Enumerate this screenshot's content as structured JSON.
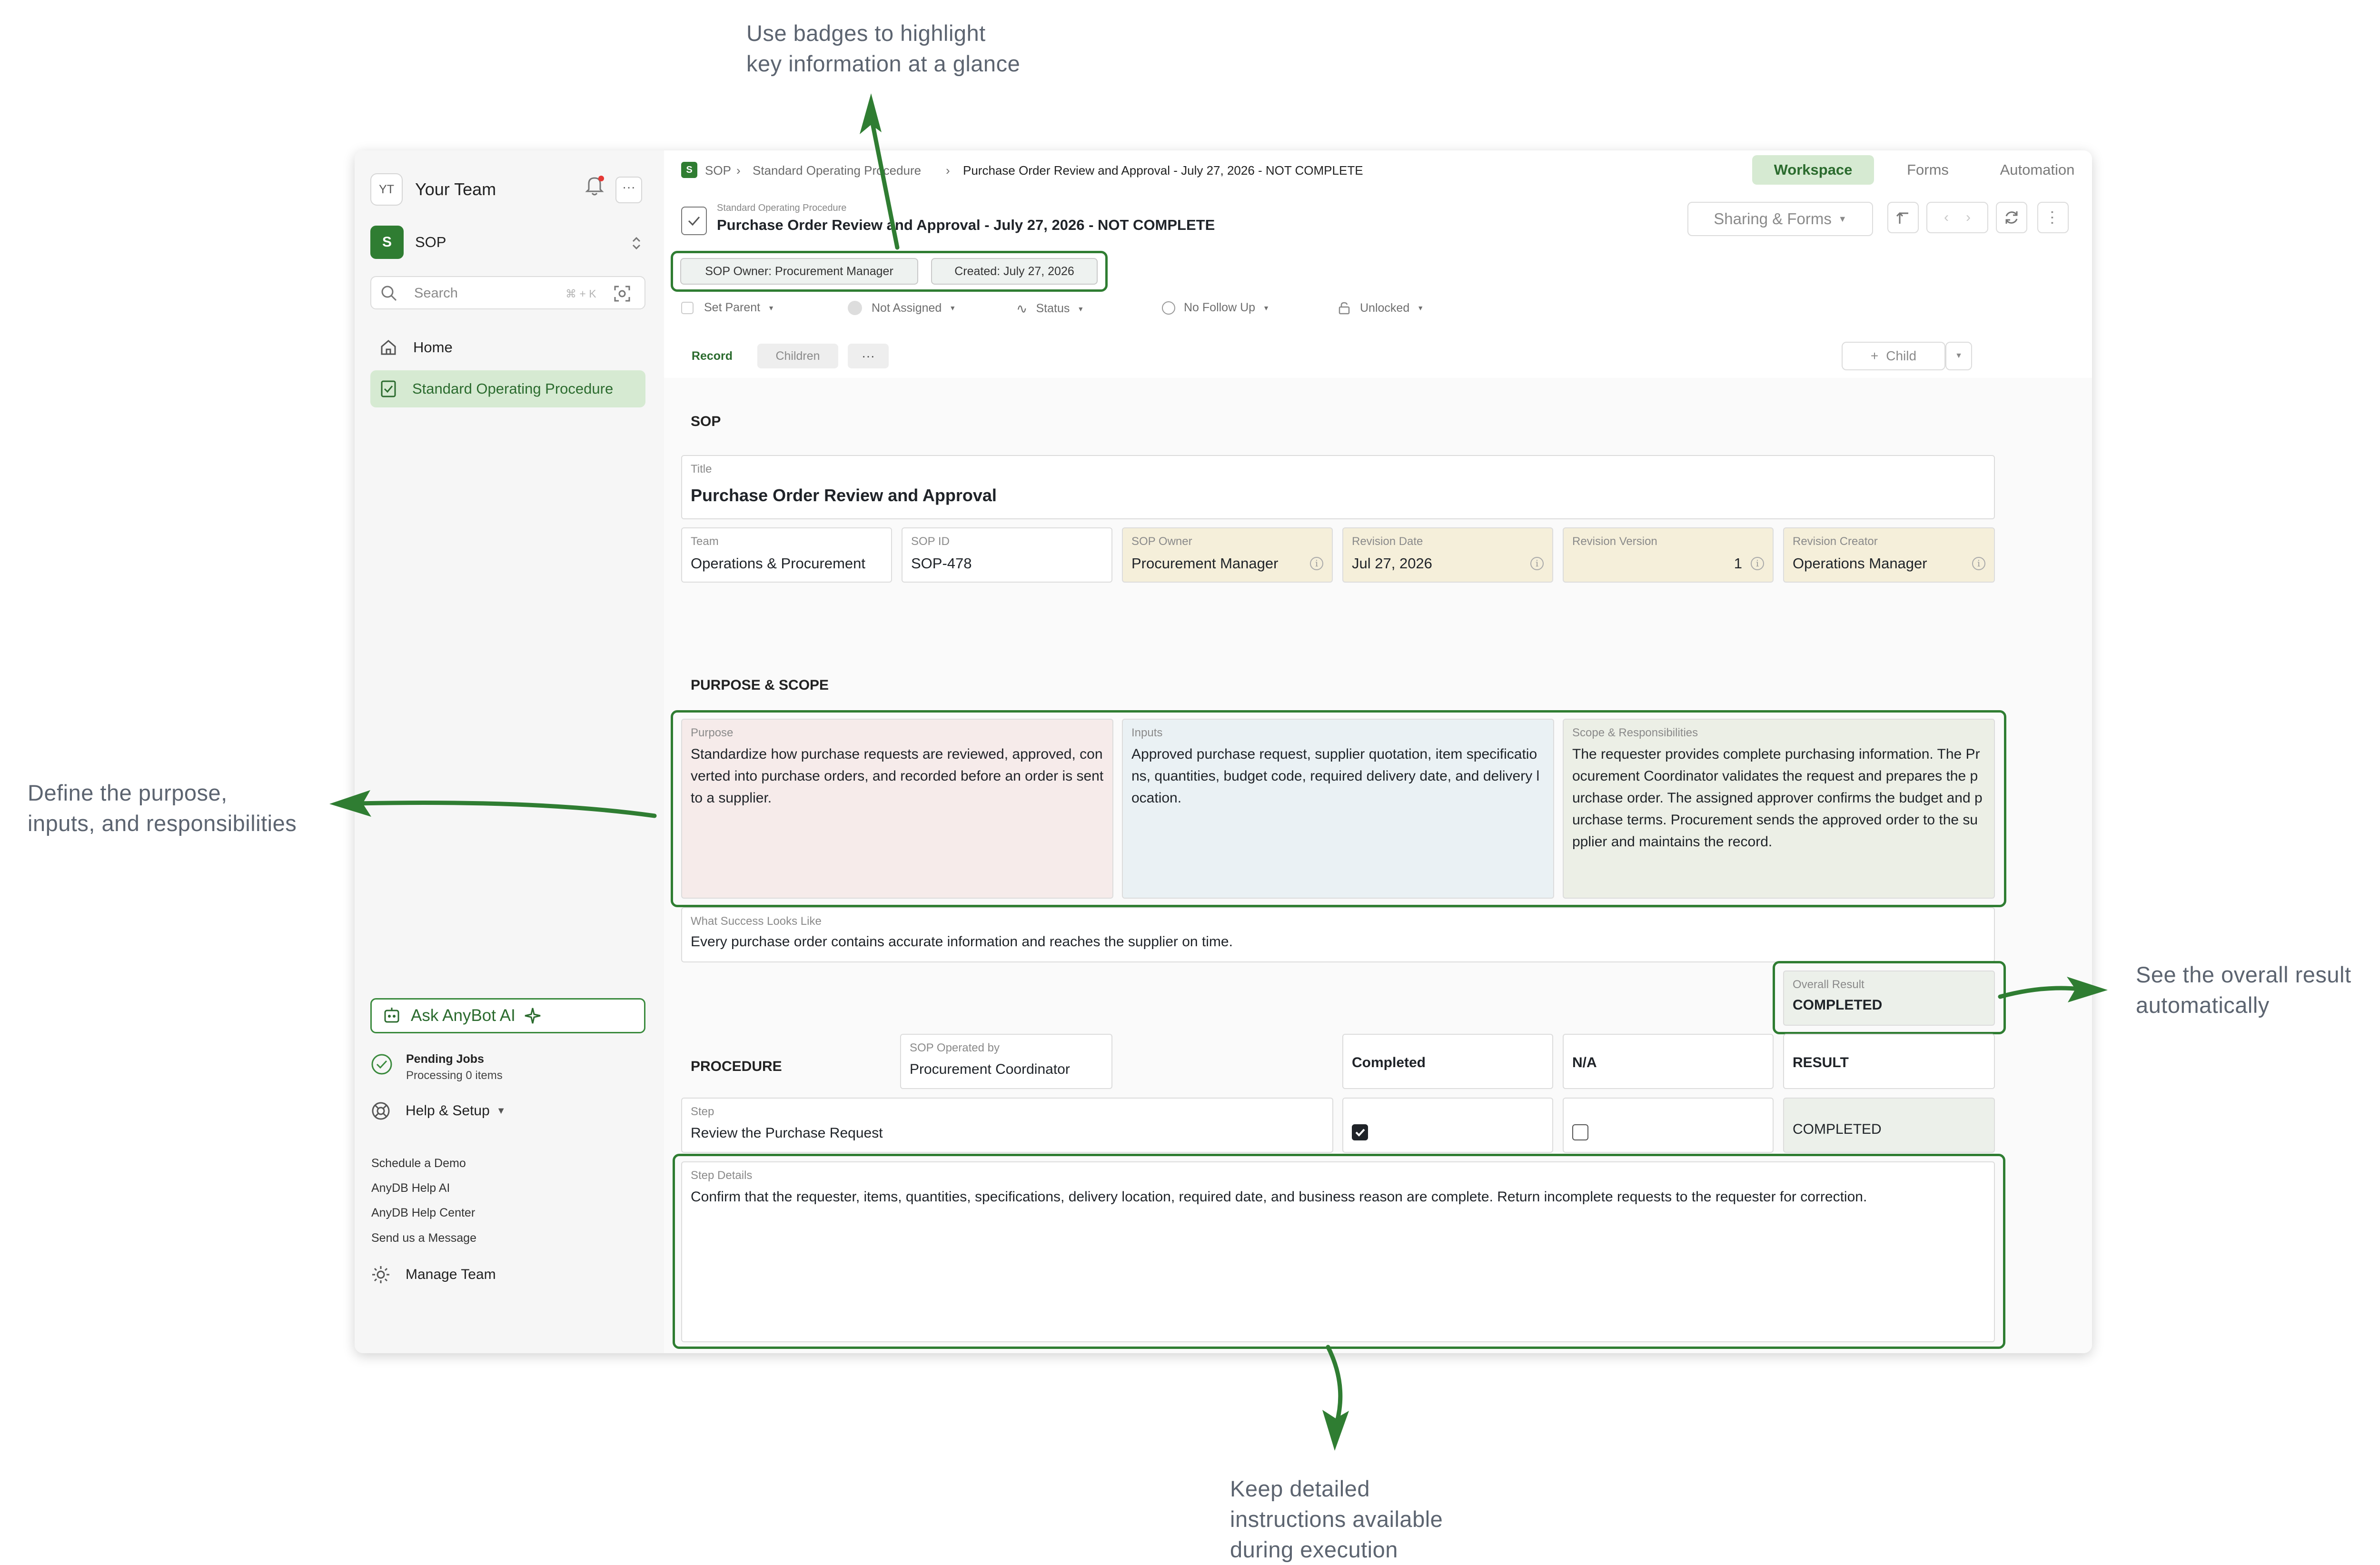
{
  "annotations": {
    "badges": [
      "Use badges to highlight",
      "key information at a glance"
    ],
    "purpose": [
      "Define the purpose,",
      "inputs, and responsibilities"
    ],
    "result": [
      "See the overall result",
      "automatically"
    ],
    "details": [
      "Keep detailed",
      "instructions available",
      "during execution"
    ]
  },
  "sidebar": {
    "team_initials": "YT",
    "team_name": "Your Team",
    "workspace_initial": "S",
    "workspace_name": "SOP",
    "search_placeholder": "Search",
    "search_shortcut": "⌘ + K",
    "nav": [
      {
        "label": "Home"
      },
      {
        "label": "Standard Operating Procedure"
      }
    ],
    "ask_label": "Ask AnyBot AI",
    "pending_title": "Pending Jobs",
    "pending_sub": "Processing 0 items",
    "help_label": "Help & Setup",
    "links": [
      "Schedule a Demo",
      "AnyDB Help AI",
      "AnyDB Help Center",
      "Send us a Message"
    ],
    "manage_team": "Manage Team"
  },
  "header": {
    "breadcrumb": [
      "SOP",
      "Standard Operating Procedure",
      "Purchase Order Review and Approval - July 27, 2026 - NOT COMPLETE"
    ],
    "tabs": [
      "Workspace",
      "Forms",
      "Automation"
    ],
    "record_type": "Standard Operating Procedure",
    "record_title": "Purchase Order Review and Approval - July 27, 2026 - NOT COMPLETE",
    "sharing_label": "Sharing & Forms",
    "badges": [
      "SOP Owner: Procurement Manager",
      "Created: July 27, 2026"
    ],
    "meta": [
      "Set Parent",
      "Not Assigned",
      "Status",
      "No Follow Up",
      "Unlocked"
    ],
    "record_tabs": [
      "Record",
      "Children",
      "···"
    ],
    "child_label": "Child"
  },
  "sop": {
    "section": "SOP",
    "title_label": "Title",
    "title_value": "Purchase Order Review and Approval",
    "fields": [
      {
        "label": "Team",
        "value": "Operations & Procurement"
      },
      {
        "label": "SOP ID",
        "value": "SOP-478"
      },
      {
        "label": "SOP Owner",
        "value": "Procurement Manager"
      },
      {
        "label": "Revision Date",
        "value": "Jul 27, 2026"
      },
      {
        "label": "Revision Version",
        "value": "1"
      },
      {
        "label": "Revision Creator",
        "value": "Operations Manager"
      }
    ]
  },
  "purpose": {
    "section": "PURPOSE & SCOPE",
    "cards": [
      {
        "label": "Purpose",
        "text": "Standardize how purchase requests are reviewed, approved, converted into purchase orders, and recorded before an order is sent to a supplier.",
        "color": "#f6ebea"
      },
      {
        "label": "Inputs",
        "text": "Approved purchase request, supplier quotation, item specifications, quantities, budget code, required delivery date, and delivery location.",
        "color": "#eaf1f4"
      },
      {
        "label": "Scope & Responsibilities",
        "text": "The requester provides complete purchasing information. The Procurement Coordinator validates the request and prepares the purchase order. The assigned approver confirms the budget and purchase terms. Procurement sends the approved order to the supplier and maintains the record.",
        "color": "#ecefe6"
      }
    ],
    "success_label": "What Success Looks Like",
    "success_text": "Every purchase order contains accurate information and reaches the supplier on time.",
    "overall_label": "Overall Result",
    "overall_value": "COMPLETED"
  },
  "procedure": {
    "section": "PROCEDURE",
    "operated_label": "SOP Operated by",
    "operated_value": "Procurement Coordinator",
    "col_completed": "Completed",
    "col_na": "N/A",
    "col_result": "RESULT",
    "step_label": "Step",
    "step_value": "Review the Purchase Request",
    "completed": true,
    "na": false,
    "result": "COMPLETED",
    "details_label": "Step Details",
    "details_text": "Confirm that the requester, items, quantities, specifications, delivery location, required date, and business reason are complete. Return incomplete requests to the requester for correction."
  },
  "colors": {
    "accent": "#2f7d32",
    "accent_soft": "#d6ead2",
    "readonly": "#f5efda",
    "result_bg": "#ecf0ea"
  }
}
